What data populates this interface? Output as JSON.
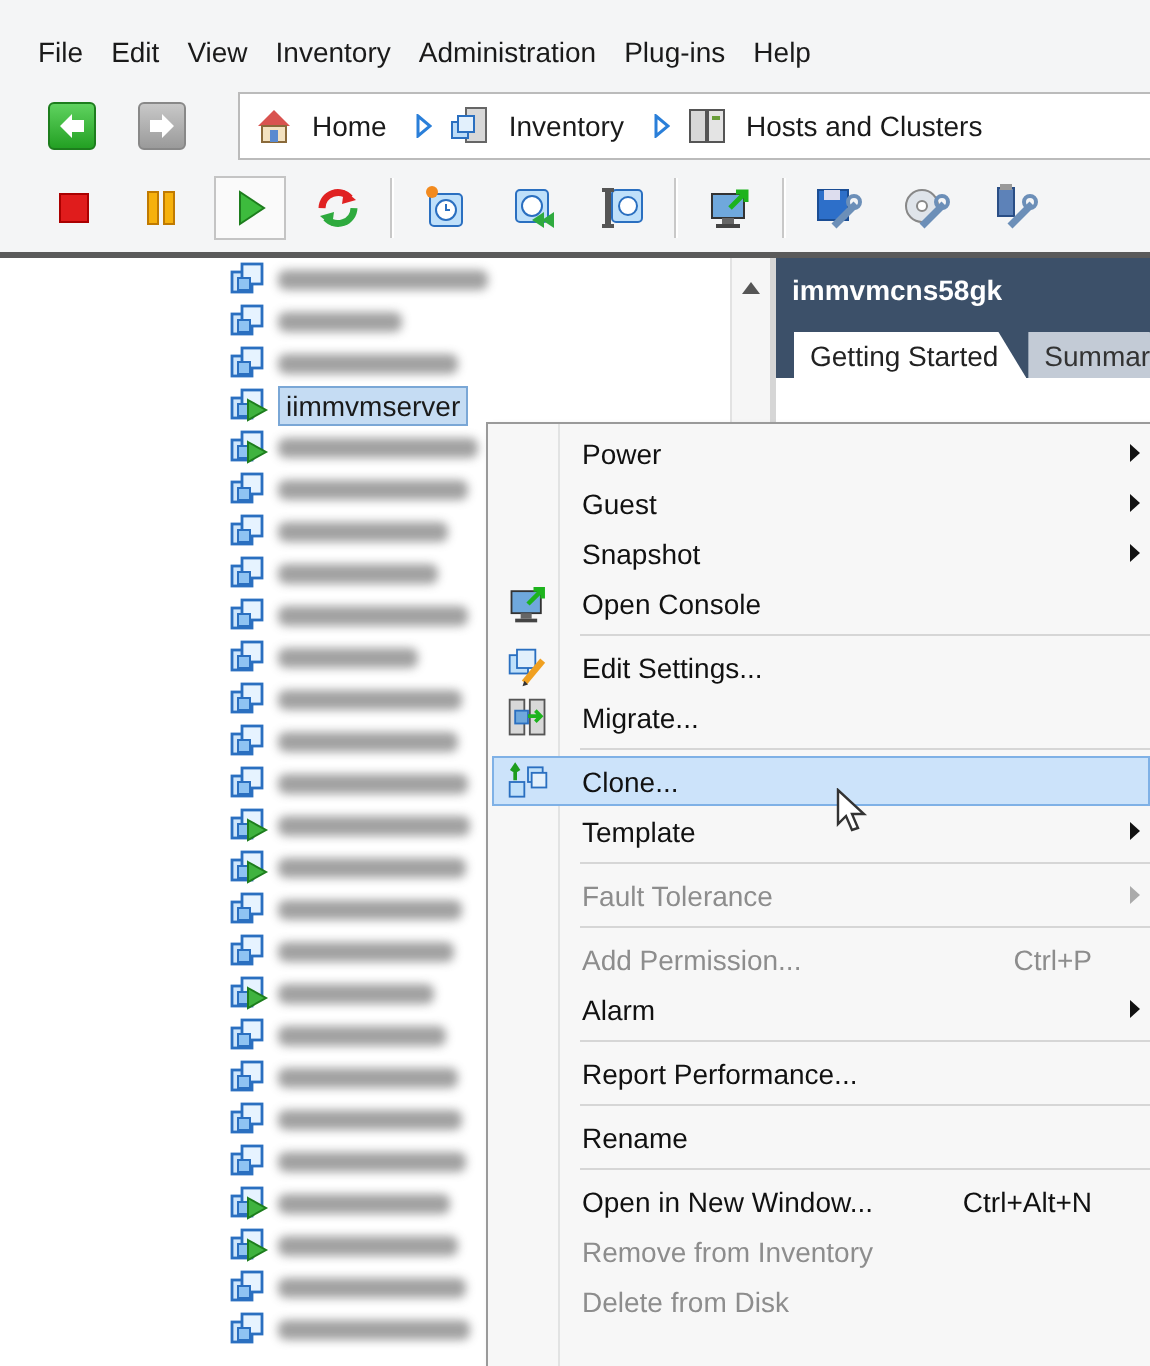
{
  "menu_bar": [
    "File",
    "Edit",
    "View",
    "Inventory",
    "Administration",
    "Plug-ins",
    "Help"
  ],
  "navigation": {
    "back": {
      "disabled": false
    },
    "forward": {
      "disabled": true
    }
  },
  "breadcrumb": [
    {
      "kind": "home",
      "label": "Home"
    },
    {
      "kind": "inventory",
      "label": "Inventory"
    },
    {
      "kind": "hosts",
      "label": "Hosts and Clusters"
    }
  ],
  "toolbar_groups": [
    [
      {
        "kind": "stop",
        "pressed": false
      },
      {
        "kind": "pause",
        "pressed": false
      },
      {
        "kind": "play",
        "pressed": true
      },
      {
        "kind": "reset",
        "pressed": false
      }
    ],
    [
      {
        "kind": "snapshot-take",
        "pressed": false
      },
      {
        "kind": "snapshot-revert",
        "pressed": false
      },
      {
        "kind": "snapshot-manage",
        "pressed": false
      }
    ],
    [
      {
        "kind": "console",
        "pressed": false
      }
    ],
    [
      {
        "kind": "floppy",
        "pressed": false
      },
      {
        "kind": "cd",
        "pressed": false
      },
      {
        "kind": "usb",
        "pressed": false
      }
    ]
  ],
  "inventory_tree": {
    "rows": [
      {
        "powered_on": false,
        "selected": false
      },
      {
        "powered_on": false,
        "selected": false
      },
      {
        "powered_on": false,
        "selected": false
      },
      {
        "label": "iimmvmserver",
        "powered_on": true,
        "selected": true
      },
      {
        "powered_on": true,
        "selected": false
      },
      {
        "powered_on": false,
        "selected": false
      },
      {
        "powered_on": false,
        "selected": false
      },
      {
        "powered_on": false,
        "selected": false
      },
      {
        "powered_on": false,
        "selected": false
      },
      {
        "powered_on": false,
        "selected": false
      },
      {
        "powered_on": false,
        "selected": false
      },
      {
        "powered_on": false,
        "selected": false
      },
      {
        "powered_on": false,
        "selected": false
      },
      {
        "powered_on": true,
        "selected": false
      },
      {
        "powered_on": true,
        "selected": false
      },
      {
        "powered_on": false,
        "selected": false
      },
      {
        "powered_on": false,
        "selected": false
      },
      {
        "powered_on": true,
        "selected": false
      },
      {
        "powered_on": false,
        "selected": false
      },
      {
        "powered_on": false,
        "selected": false
      },
      {
        "powered_on": false,
        "selected": false
      },
      {
        "powered_on": false,
        "selected": false
      },
      {
        "powered_on": true,
        "selected": false
      },
      {
        "powered_on": true,
        "selected": false
      },
      {
        "powered_on": false,
        "selected": false
      },
      {
        "powered_on": false,
        "selected": false
      }
    ]
  },
  "detail_panel": {
    "title": "immvmcns58gk",
    "tabs": [
      {
        "label": "Getting Started",
        "selected": true
      },
      {
        "label": "Summar",
        "selected": false
      }
    ]
  },
  "context_menu": [
    {
      "kind": "plain",
      "label": "Power",
      "submenu": true,
      "disabled": false,
      "selected": false
    },
    {
      "kind": "plain",
      "label": "Guest",
      "submenu": true,
      "disabled": false,
      "selected": false
    },
    {
      "kind": "plain",
      "label": "Snapshot",
      "submenu": true,
      "disabled": false,
      "selected": false
    },
    {
      "kind": "console",
      "label": "Open Console",
      "submenu": false,
      "disabled": false,
      "selected": false
    },
    {
      "kind": "separator"
    },
    {
      "kind": "edit",
      "label": "Edit Settings...",
      "submenu": false,
      "disabled": false,
      "selected": false
    },
    {
      "kind": "migrate",
      "label": "Migrate...",
      "submenu": false,
      "disabled": false,
      "selected": false
    },
    {
      "kind": "separator"
    },
    {
      "kind": "clone",
      "label": "Clone...",
      "submenu": false,
      "disabled": false,
      "selected": true
    },
    {
      "kind": "plain",
      "label": "Template",
      "submenu": true,
      "disabled": false,
      "selected": false
    },
    {
      "kind": "separator"
    },
    {
      "kind": "plain",
      "label": "Fault Tolerance",
      "submenu": true,
      "disabled": true,
      "selected": false
    },
    {
      "kind": "separator"
    },
    {
      "kind": "plain",
      "label": "Add Permission...",
      "shortcut": "Ctrl+P",
      "submenu": false,
      "disabled": true,
      "selected": false
    },
    {
      "kind": "plain",
      "label": "Alarm",
      "submenu": true,
      "disabled": false,
      "selected": false
    },
    {
      "kind": "separator"
    },
    {
      "kind": "plain",
      "label": "Report Performance...",
      "submenu": false,
      "disabled": false,
      "selected": false
    },
    {
      "kind": "separator"
    },
    {
      "kind": "plain",
      "label": "Rename",
      "submenu": false,
      "disabled": false,
      "selected": false
    },
    {
      "kind": "separator"
    },
    {
      "kind": "plain",
      "label": "Open in New Window...",
      "shortcut": "Ctrl+Alt+N",
      "submenu": false,
      "disabled": false,
      "selected": false
    },
    {
      "kind": "plain",
      "label": "Remove from Inventory",
      "submenu": false,
      "disabled": true,
      "selected": false
    },
    {
      "kind": "plain",
      "label": "Delete from Disk",
      "submenu": false,
      "disabled": true,
      "selected": false
    }
  ]
}
